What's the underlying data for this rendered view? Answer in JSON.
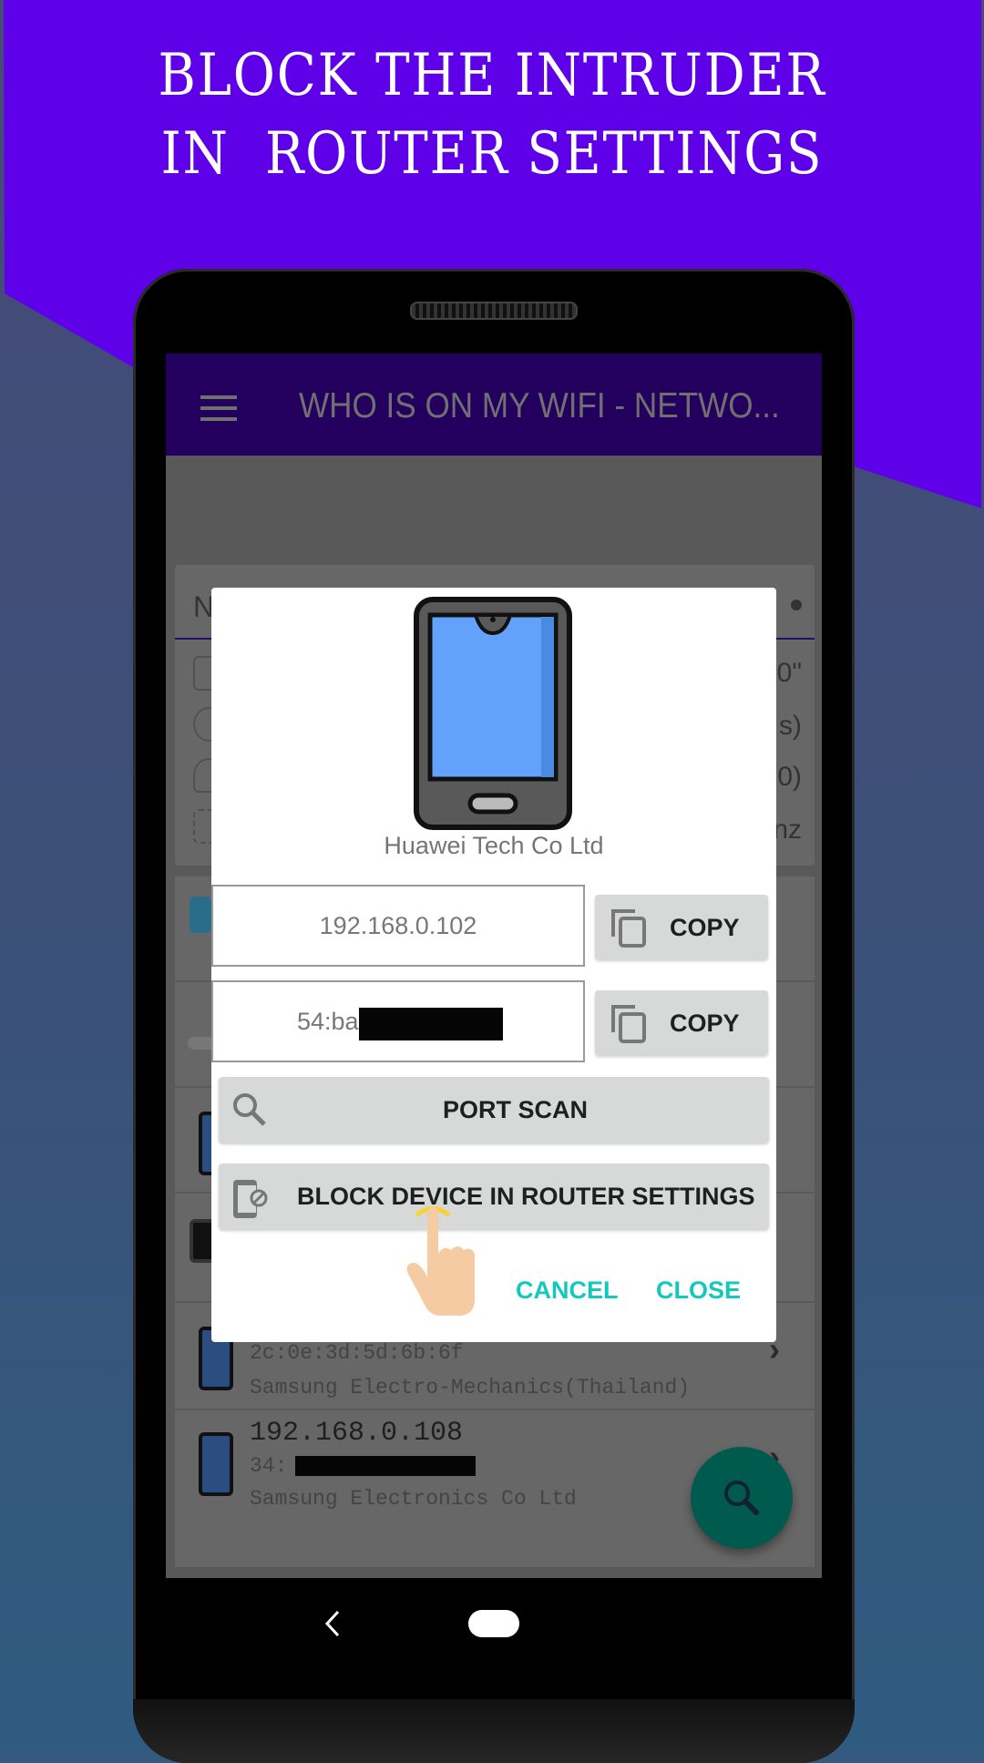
{
  "headline": {
    "line1": "BLOCK THE INTRUDER",
    "line2": "IN  ROUTER SETTINGS"
  },
  "colors": {
    "purple": "#5e00e8",
    "appbar": "#24005e",
    "accent_text": "#12c9bc",
    "fab": "#005a4e",
    "button_bg": "#d7d8d8"
  },
  "app": {
    "title": "WHO IS ON MY WIFI - NETWO...",
    "menu_icon": "hamburger-icon",
    "card": {
      "header_partial": "N",
      "values_partial": [
        "0\"",
        "s)",
        "0)",
        "nz"
      ]
    },
    "list": [
      {
        "icon": "printer-icon",
        "ip": "",
        "mac": "",
        "vendor": ""
      },
      {
        "icon": "router-icon",
        "ip": "",
        "mac": "",
        "vendor": ""
      },
      {
        "icon": "phone-icon",
        "ip": "",
        "mac": "",
        "vendor": ""
      },
      {
        "icon": "monitor-icon",
        "ip": "",
        "mac": "",
        "vendor": ""
      },
      {
        "icon": "phone-icon",
        "ip": "",
        "mac": "2c:0e:3d:5d:6b:6f",
        "vendor": "Samsung Electro-Mechanics(Thailand)"
      },
      {
        "icon": "phone-icon",
        "ip": "192.168.0.108",
        "mac": "34:",
        "vendor": "Samsung Electronics Co Ltd"
      }
    ],
    "fab_icon": "search-icon"
  },
  "dialog": {
    "device_icon": "smartphone-icon",
    "vendor": "Huawei Tech Co Ltd",
    "ip": "192.168.0.102",
    "mac_visible": "54:ba",
    "copy_label": "COPY",
    "port_scan_label": "PORT SCAN",
    "block_label": "BLOCK DEVICE IN ROUTER SETTINGS",
    "cancel_label": "CANCEL",
    "close_label": "CLOSE"
  },
  "navbar": {
    "back_icon": "back-icon",
    "home_icon": "home-pill-icon"
  }
}
